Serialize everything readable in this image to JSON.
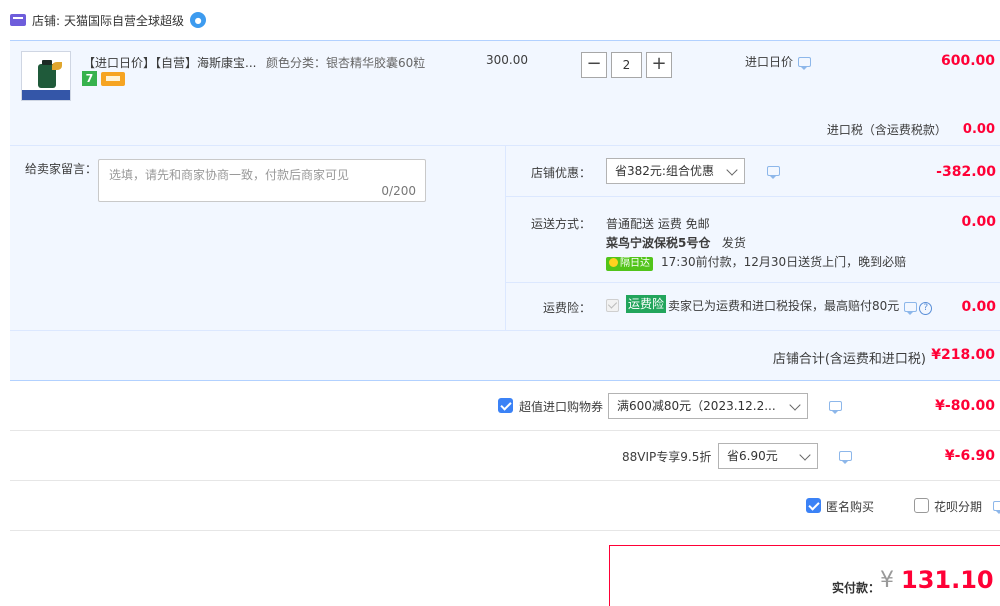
{
  "shop": {
    "label": "店铺:",
    "name": "天猫国际自营全球超级"
  },
  "item": {
    "title": "【进口日价】【自营】海斯康宝...",
    "sku": "颜色分类：银杏精华胶囊60粒",
    "badge_7": "7",
    "unit_price": "300.00",
    "quantity": "2",
    "minus": "−",
    "plus": "+",
    "import_label": "进口日价",
    "total": "600.00"
  },
  "tax": {
    "label": "进口税（含运费税款）",
    "value": "0.00"
  },
  "message": {
    "label": "给卖家留言：",
    "placeholder": "选填，请先和商家协商一致，付款后商家可见",
    "count": "0/200"
  },
  "shop_discount": {
    "label": "店铺优惠：",
    "selected": "省382元:组合优惠",
    "value": "-382.00"
  },
  "shipping": {
    "label": "运送方式：",
    "method": "普通配送 运费 免邮",
    "warehouse": "菜鸟宁波保税5号仓",
    "dispatch": "发货",
    "tag": "隔日达",
    "promise": "17:30前付款，12月30日送货上门，晚到必赔",
    "value": "0.00"
  },
  "insurance": {
    "label": "运费险：",
    "tag": "运费险",
    "text": "卖家已为运费和进口税投保，最高赔付80元",
    "help": "?",
    "value": "0.00"
  },
  "shop_total": {
    "label": "店铺合计(含运费和进口税)",
    "value": "¥218.00"
  },
  "coupon": {
    "label": "超值进口购物券",
    "checked": true,
    "selected": "满600减80元（2023.12.2...",
    "value": "¥-80.00"
  },
  "vip": {
    "label": "88VIP专享9.5折",
    "selected": "省6.90元",
    "value": "¥-6.90"
  },
  "options": {
    "anonymous_label": "匿名购买",
    "anonymous_checked": true,
    "huabei_label": "花呗分期",
    "huabei_checked": false
  },
  "payment": {
    "label": "实付款：",
    "currency": "¥",
    "amount": "131.10"
  },
  "colors": {
    "accent_red": "#ff0036",
    "block_bg": "#f2f7ff",
    "checkbox_blue": "#3b82f6",
    "tag_green": "#22a55c"
  }
}
